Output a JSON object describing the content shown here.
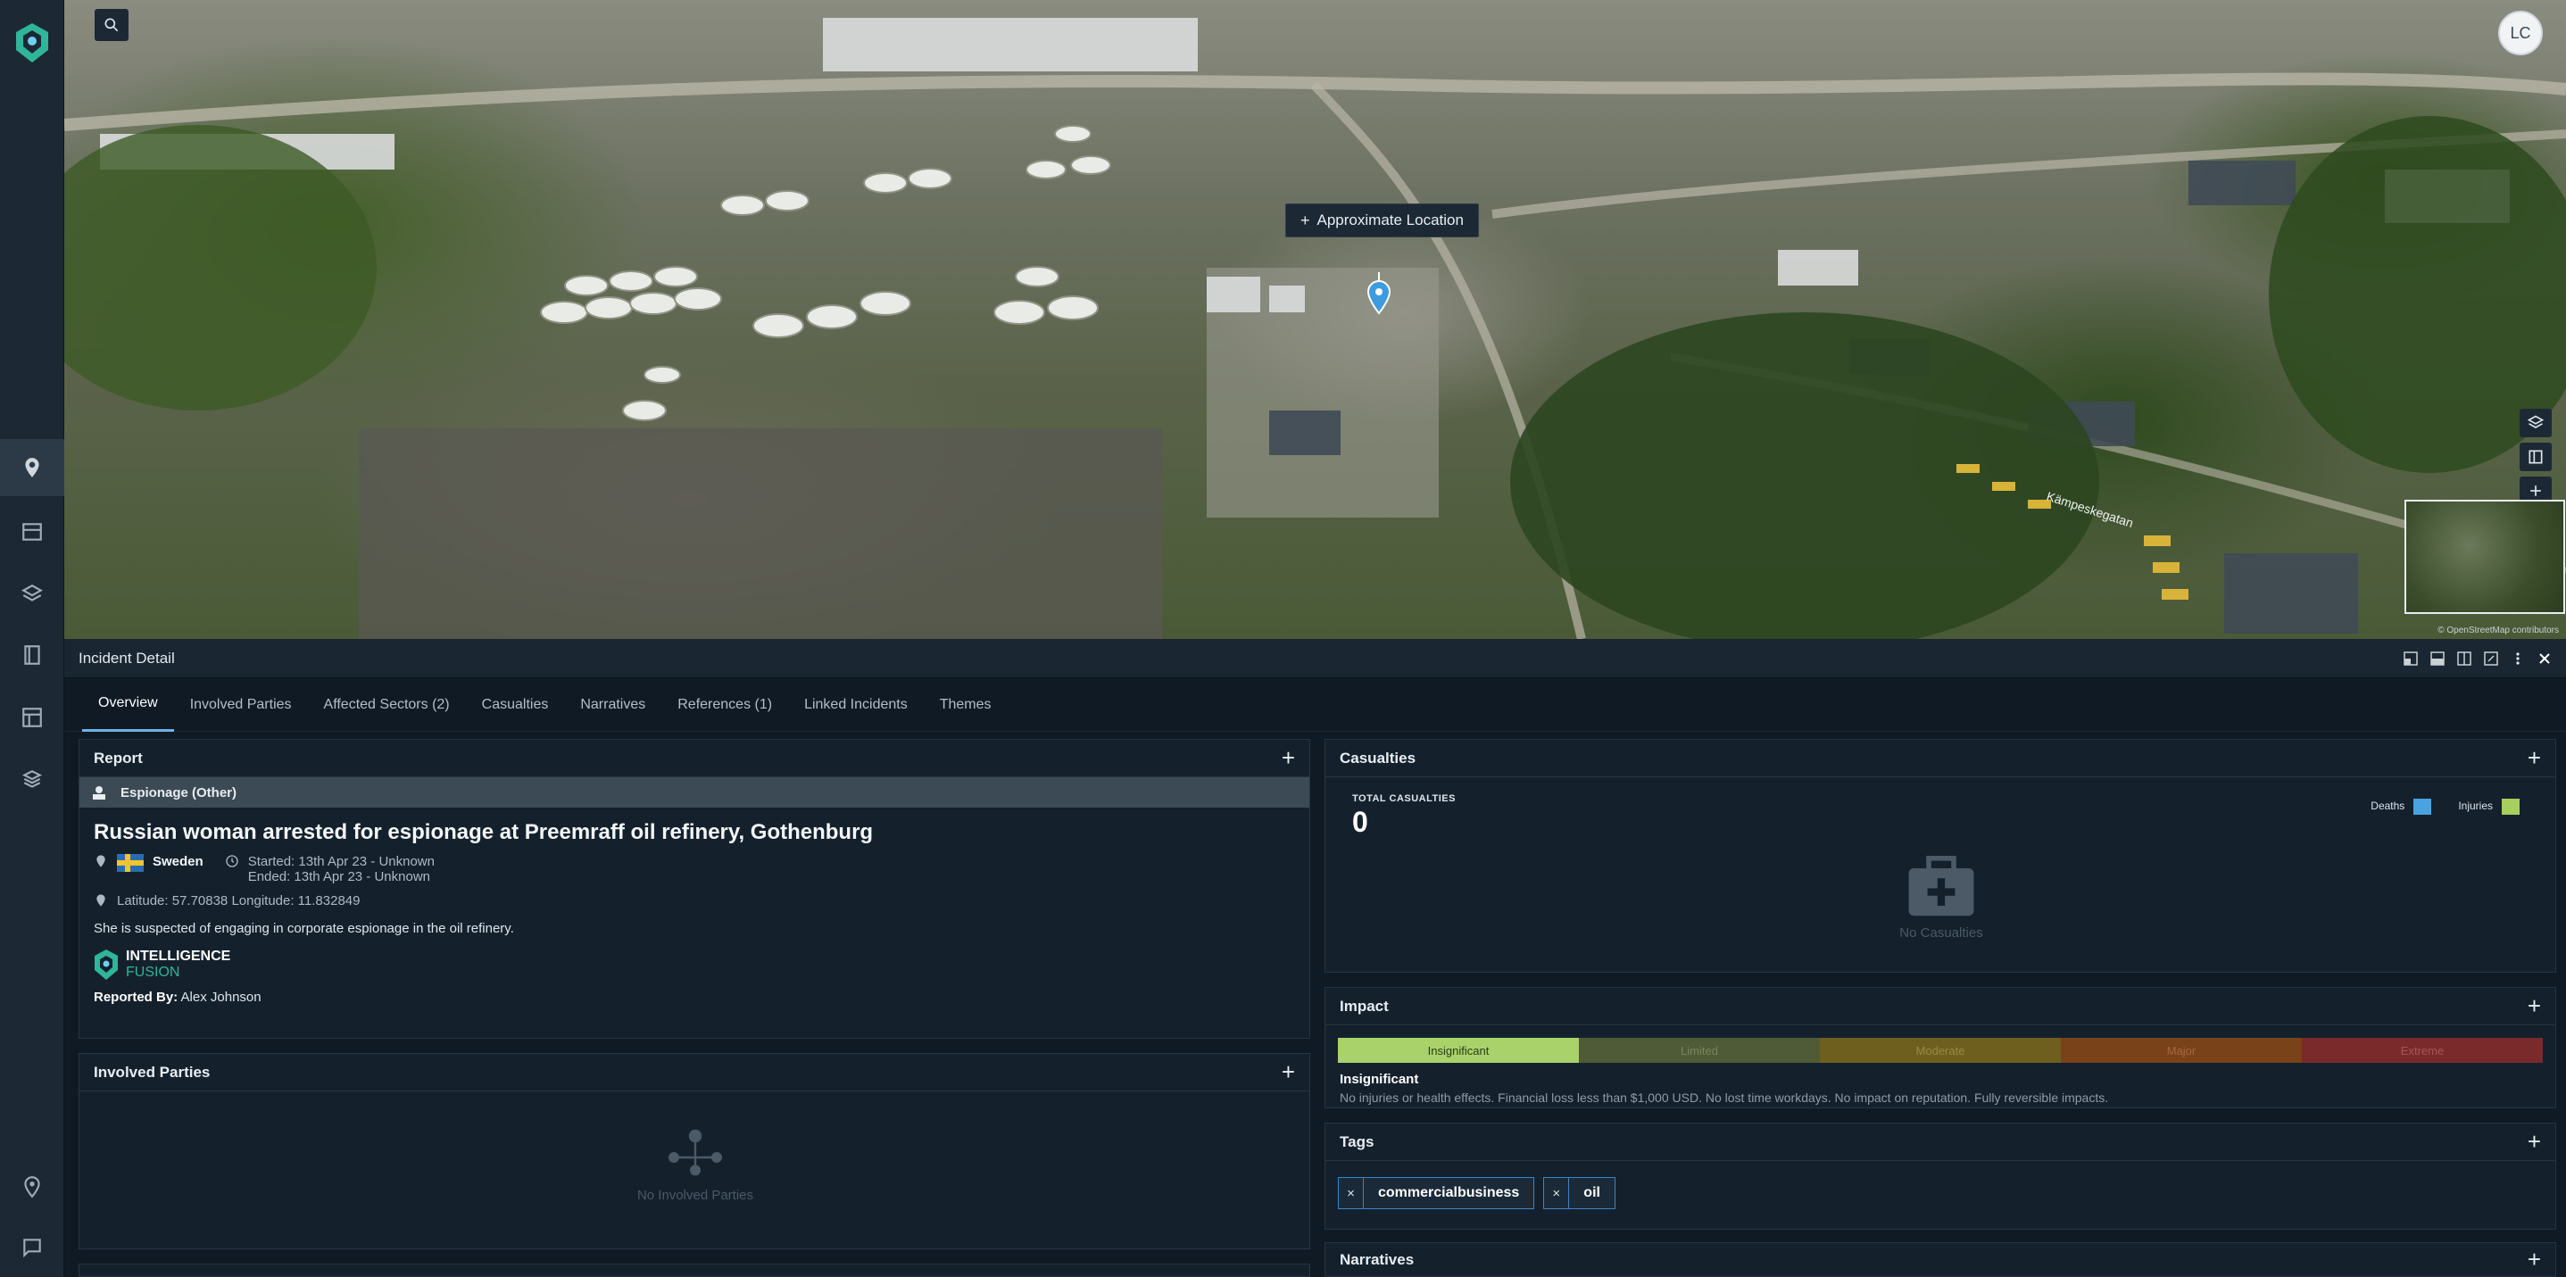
{
  "map": {
    "avatar_initials": "LC",
    "approx_label": "Approximate Location",
    "attribution": "© OpenStreetMap contributors",
    "street_labels": [
      "Kämpeskegatan"
    ]
  },
  "panel": {
    "title": "Incident Detail",
    "tabs": [
      {
        "label": "Overview",
        "active": true
      },
      {
        "label": "Involved Parties"
      },
      {
        "label": "Affected Sectors (2)"
      },
      {
        "label": "Casualties"
      },
      {
        "label": "Narratives"
      },
      {
        "label": "References (1)"
      },
      {
        "label": "Linked Incidents"
      },
      {
        "label": "Themes"
      }
    ]
  },
  "report": {
    "header": "Report",
    "category": "Espionage (Other)",
    "headline": "Russian woman arrested for espionage at Preemraff oil refinery, Gothenburg",
    "country": "Sweden",
    "started": "Started: 13th Apr 23 - Unknown",
    "ended": "Ended: 13th Apr 23 - Unknown",
    "coords": "Latitude: 57.70838 Longitude: 11.832849",
    "description": "She is suspected of engaging in corporate espionage in the oil refinery.",
    "brand_line1": "INTELLIGENCE",
    "brand_line2": "FUSION",
    "reported_by_label": "Reported By:",
    "reported_by": "Alex Johnson"
  },
  "involved": {
    "header": "Involved Parties",
    "empty": "No Involved Parties"
  },
  "casualties": {
    "header": "Casualties",
    "total_label": "TOTAL CASUALTIES",
    "total": "0",
    "legend_deaths": "Deaths",
    "legend_injuries": "Injuries",
    "deaths_color": "#4aa3e0",
    "injuries_color": "#a6cf5e",
    "empty": "No Casualties"
  },
  "impact": {
    "header": "Impact",
    "levels": [
      {
        "label": "Insignificant",
        "color": "#a9d36a",
        "text": "#2b3a1a"
      },
      {
        "label": "Limited",
        "color": "#4f5a36",
        "text": "#7b8660"
      },
      {
        "label": "Moderate",
        "color": "#6f5f1f",
        "text": "#9a8944"
      },
      {
        "label": "Major",
        "color": "#7a4218",
        "text": "#a46840"
      },
      {
        "label": "Extreme",
        "color": "#7a2a2a",
        "text": "#a45656"
      }
    ],
    "selected": "Insignificant",
    "description": "No injuries or health effects. Financial loss less than $1,000 USD. No lost time workdays. No impact on reputation. Fully reversible impacts."
  },
  "tags": {
    "header": "Tags",
    "items": [
      "commercialbusiness",
      "oil"
    ]
  },
  "narratives": {
    "header": "Narratives"
  }
}
